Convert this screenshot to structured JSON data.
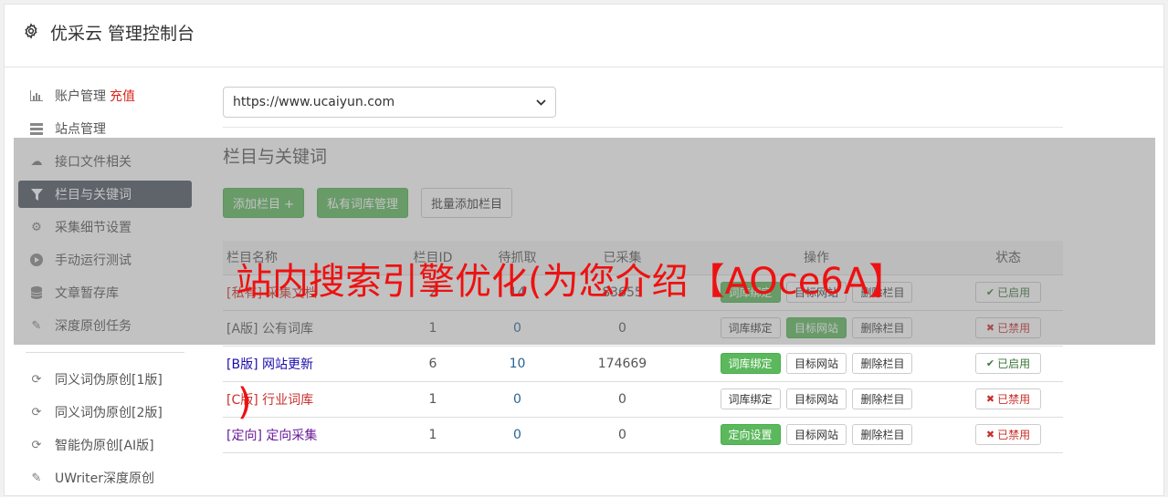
{
  "header": {
    "title": "优采云 管理控制台",
    "icon": "gear-icon"
  },
  "sidebar": {
    "items": [
      {
        "label": "账户管理",
        "extra": "充值",
        "icon": "bar-chart-icon"
      },
      {
        "label": "站点管理",
        "icon": "server-icon"
      },
      {
        "label": "接口文件相关",
        "icon": "cloud-upload-icon"
      },
      {
        "label": "栏目与关键词",
        "icon": "filter-icon",
        "active": true
      },
      {
        "label": "采集细节设置",
        "icon": "cogs-icon"
      },
      {
        "label": "手动运行测试",
        "icon": "play-circle-icon"
      },
      {
        "label": "文章暂存库",
        "icon": "database-icon"
      },
      {
        "label": "深度原创任务",
        "icon": "edit-icon"
      }
    ],
    "items2": [
      {
        "label": "同义词伪原创[1版]",
        "icon": "refresh-icon"
      },
      {
        "label": "同义词伪原创[2版]",
        "icon": "refresh-icon"
      },
      {
        "label": "智能伪原创[AI版]",
        "icon": "refresh-icon"
      },
      {
        "label": "UWriter深度原创",
        "icon": "edit-icon"
      }
    ]
  },
  "site_select": {
    "value": "https://www.ucaiyun.com"
  },
  "section": {
    "title": "栏目与关键词"
  },
  "buttons": {
    "add": "添加栏目 +",
    "private": "私有词库管理",
    "batch": "批量添加栏目"
  },
  "table": {
    "headers": [
      "栏目名称",
      "栏目ID",
      "待抓取",
      "已采集",
      "操作",
      "状态"
    ],
    "rows": [
      {
        "name": "[私有] 采集文档",
        "id": "2",
        "pending": "14",
        "collected": "83655",
        "op1": "词库绑定",
        "op2": "目标网站",
        "op3": "删除栏目",
        "status": "已启用"
      },
      {
        "name": "[A版] 公有词库",
        "id": "1",
        "pending": "0",
        "collected": "0",
        "op1": "词库绑定",
        "op2": "目标网站",
        "op3": "删除栏目",
        "status": "已禁用"
      },
      {
        "name": "[B版] 网站更新",
        "id": "6",
        "pending": "10",
        "collected": "174669",
        "op1": "词库绑定",
        "op2": "目标网站",
        "op3": "删除栏目",
        "status": "已启用"
      },
      {
        "name": "[C版] 行业词库",
        "id": "1",
        "pending": "0",
        "collected": "0",
        "op1": "词库绑定",
        "op2": "目标网站",
        "op3": "删除栏目",
        "status": "已禁用"
      },
      {
        "name": "[定向] 定向采集",
        "id": "1",
        "pending": "0",
        "collected": "0",
        "op1": "定向设置",
        "op2": "目标网站",
        "op3": "删除栏目",
        "status": "已禁用"
      }
    ]
  },
  "overlay_text": {
    "line1": "站内搜索引擎优化(为您介绍【AOce6A】",
    "line2": ")"
  },
  "colors": {
    "active_nav": "#4b5462",
    "green": "#5cb85c",
    "red_text": "#ee1111"
  }
}
